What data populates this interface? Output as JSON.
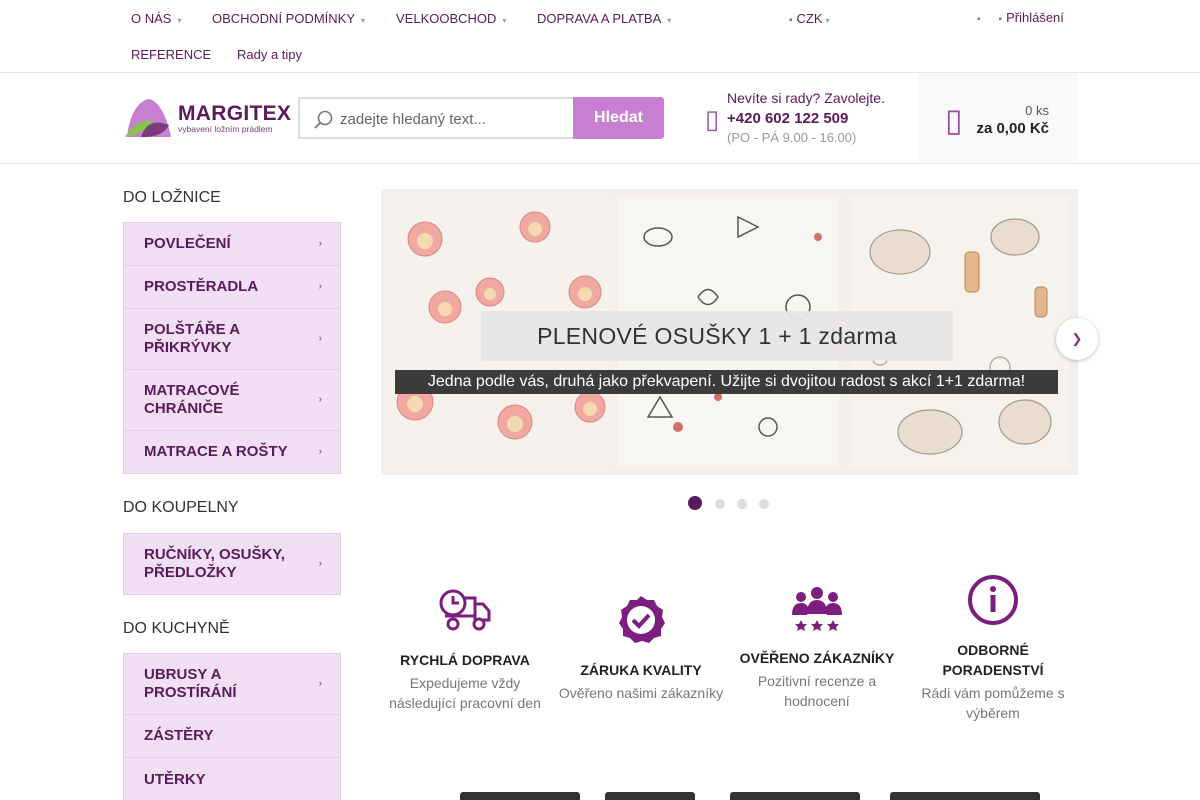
{
  "topnav": {
    "items": [
      {
        "label": "O NÁS",
        "has_dropdown": true
      },
      {
        "label": "OBCHODNÍ PODMÍNKY",
        "has_dropdown": true
      },
      {
        "label": "VELKOOBCHOD",
        "has_dropdown": true
      },
      {
        "label": "DOPRAVA A PLATBA",
        "has_dropdown": true
      },
      {
        "label": "REFERENCE",
        "has_dropdown": false
      },
      {
        "label": "Rady a tipy",
        "has_dropdown": false
      }
    ],
    "currency": "CZK",
    "login": "Přihlášení"
  },
  "header": {
    "logo": {
      "name": "MARGITEX",
      "tagline": "vybavení ložním prádlem"
    },
    "search": {
      "placeholder": "zadejte hledaný text...",
      "button": "Hledat"
    },
    "contact": {
      "question": "Nevíte si rady? Zavolejte.",
      "phone": "+420 602 122 509",
      "hours": "(PO - PÁ 9.00 - 16.00)"
    },
    "cart": {
      "count": "0 ks",
      "total": "za 0,00 Kč"
    }
  },
  "sidebar": {
    "sections": [
      {
        "title": "DO LOŽNICE",
        "items": [
          "POVLEČENÍ",
          "PROSTĚRADLA",
          "POLŠTÁŘE A PŘIKRÝVKY",
          "MATRACOVÉ CHRÁNIČE",
          "MATRACE A ROŠTY"
        ]
      },
      {
        "title": "DO KOUPELNY",
        "items": [
          "RUČNÍKY, OSUŠKY, PŘEDLOŽKY"
        ]
      },
      {
        "title": "DO KUCHYNĚ",
        "items": [
          "UBRUSY A PROSTÍRÁNÍ",
          "ZÁSTĚRY",
          "UTĚRKY"
        ]
      }
    ]
  },
  "banner": {
    "headline": "PLENOVÉ OSUŠKY  1 + 1 zdarma",
    "subline": "Jedna podle vás, druhá jako překvapení. Užijte si dvojitou radost s akcí 1+1 zdarma!",
    "slide_count": 4,
    "active_slide": 1
  },
  "benefits": [
    {
      "icon": "delivery-truck-icon",
      "title": "RYCHLÁ DOPRAVA",
      "desc": "Expedujeme vždy následující pracovní den"
    },
    {
      "icon": "quality-badge-icon",
      "title": "ZÁRUKA KVALITY",
      "desc": "Ověřeno našimi zákazníky"
    },
    {
      "icon": "customers-stars-icon",
      "title": "OVĚŘENO ZÁKAZNÍKY",
      "desc": "Pozitivní recenze a hodnocení"
    },
    {
      "icon": "info-circle-icon",
      "title": "ODBORNÉ PORADENSTVÍ",
      "desc": "Rádi vám pomůžeme s výběrem"
    }
  ],
  "colors": {
    "brand": "#5a1a5c",
    "accent": "#c77fd1",
    "category_bg": "#f1dff3"
  }
}
